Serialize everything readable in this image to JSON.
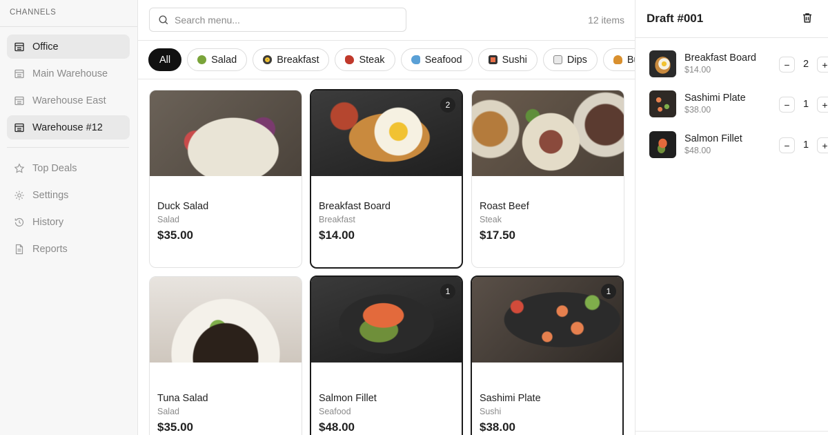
{
  "sidebar": {
    "heading": "CHANNELS",
    "channels": [
      {
        "label": "Office",
        "active": true
      },
      {
        "label": "Main Warehouse",
        "active": false
      },
      {
        "label": "Warehouse East",
        "active": false
      },
      {
        "label": "Warehouse #12",
        "active": true
      }
    ],
    "links": [
      {
        "label": "Top Deals",
        "icon": "star-icon"
      },
      {
        "label": "Settings",
        "icon": "gear-icon"
      },
      {
        "label": "History",
        "icon": "history-icon"
      },
      {
        "label": "Reports",
        "icon": "report-icon"
      }
    ]
  },
  "search": {
    "placeholder": "Search menu..."
  },
  "item_count": "12 items",
  "categories": [
    {
      "label": "All",
      "active": true
    },
    {
      "label": "Salad",
      "icon": "salad-icon"
    },
    {
      "label": "Breakfast",
      "icon": "frying-pan-icon"
    },
    {
      "label": "Steak",
      "icon": "steak-icon"
    },
    {
      "label": "Seafood",
      "icon": "fish-icon"
    },
    {
      "label": "Sushi",
      "icon": "sushi-icon"
    },
    {
      "label": "Dips",
      "icon": "jar-icon"
    },
    {
      "label": "Burg",
      "icon": "burger-icon"
    }
  ],
  "menu": [
    {
      "name": "Duck Salad",
      "category": "Salad",
      "price": "$35.00",
      "selected": false,
      "qty": ""
    },
    {
      "name": "Breakfast Board",
      "category": "Breakfast",
      "price": "$14.00",
      "selected": true,
      "qty": "2"
    },
    {
      "name": "Roast Beef",
      "category": "Steak",
      "price": "$17.50",
      "selected": false,
      "qty": ""
    },
    {
      "name": "Tuna Salad",
      "category": "Salad",
      "price": "$35.00",
      "selected": false,
      "qty": ""
    },
    {
      "name": "Salmon Fillet",
      "category": "Seafood",
      "price": "$48.00",
      "selected": true,
      "qty": "1"
    },
    {
      "name": "Sashimi Plate",
      "category": "Sushi",
      "price": "$38.00",
      "selected": true,
      "qty": "1"
    }
  ],
  "order": {
    "title": "Draft #001",
    "lines": [
      {
        "name": "Breakfast Board",
        "price": "$14.00",
        "qty": "2"
      },
      {
        "name": "Sashimi Plate",
        "price": "$38.00",
        "qty": "1"
      },
      {
        "name": "Salmon Fillet",
        "price": "$48.00",
        "qty": "1"
      }
    ]
  },
  "colors": {
    "accent": "#111111",
    "muted": "#8a8a8a",
    "active_bg": "#e9e9e9"
  }
}
